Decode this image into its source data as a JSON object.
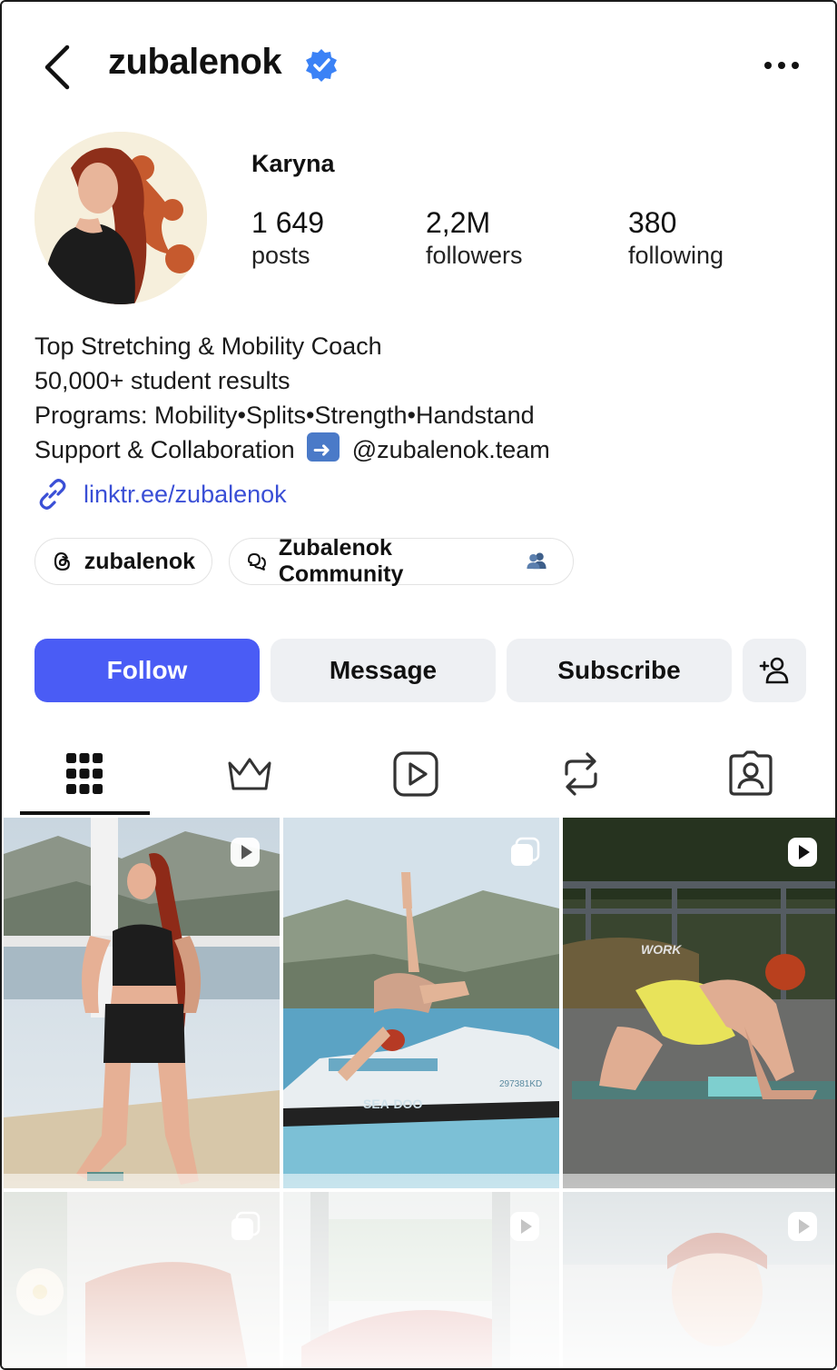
{
  "header": {
    "username": "zubalenok",
    "verified": true,
    "back_icon": "chevron-left-icon",
    "more_icon": "more-dots-icon"
  },
  "profile": {
    "display_name": "Karyna",
    "stats": [
      {
        "value": "1 649",
        "label": "posts"
      },
      {
        "value": "2,2M",
        "label": "followers"
      },
      {
        "value": "380",
        "label": "following"
      }
    ],
    "bio": {
      "line1": "Top Stretching & Mobility Coach",
      "line2": "50,000+ student results",
      "line3": "Programs: Mobility•Splits•Strength•Handstand",
      "line4_prefix": "Support & Collaboration",
      "line4_suffix": "@zubalenok.team"
    },
    "link": "linktr.ee/zubalenok",
    "chips": [
      {
        "label": "zubalenok",
        "icon": "threads-icon"
      },
      {
        "label": "Zubalenok Community",
        "icon": "community-chat-icon"
      }
    ]
  },
  "actions": {
    "follow_label": "Follow",
    "message_label": "Message",
    "subscribe_label": "Subscribe",
    "add_person_icon": "add-person-icon"
  },
  "tabs": [
    "grid-icon",
    "crown-icon",
    "reels-icon",
    "reposts-icon",
    "tagged-icon"
  ],
  "grid": {
    "posts": [
      {
        "type": "reel",
        "scene": "woman kneeling on pier, mountains behind"
      },
      {
        "type": "carousel",
        "scene": "woman in handstand pose on jet ski"
      },
      {
        "type": "reel",
        "scene": "woman stretching on mat outdoors"
      },
      {
        "type": "carousel",
        "scene": "stretching with flower"
      },
      {
        "type": "reel",
        "scene": "stretching near window"
      },
      {
        "type": "reel",
        "scene": "portrait with headband"
      }
    ],
    "overlay_texts": [
      "WORK",
      "297381KD",
      "SEA-DOO"
    ]
  },
  "colors": {
    "accent": "#4a5cf5",
    "link": "#3a4fd6",
    "verified": "#3b82f6",
    "button_grey": "#eef0f3"
  }
}
